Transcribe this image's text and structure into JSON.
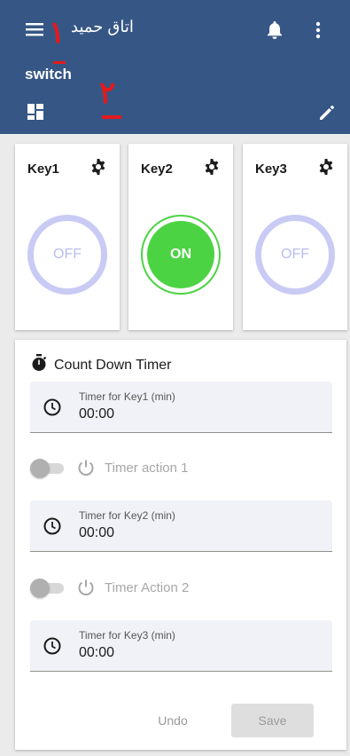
{
  "header": {
    "room_title": "اتاق حمید",
    "subtitle": "switch",
    "annotation_1": "۱",
    "annotation_2": "۲"
  },
  "keys": [
    {
      "label": "Key1",
      "state": "OFF"
    },
    {
      "label": "Key2",
      "state": "ON"
    },
    {
      "label": "Key3",
      "state": "OFF"
    }
  ],
  "timer": {
    "title": "Count Down Timer",
    "fields": [
      {
        "label": "Timer for Key1 (min)",
        "value": "00:00"
      },
      {
        "label": "Timer for Key2 (min)",
        "value": "00:00"
      },
      {
        "label": "Timer for Key3 (min)",
        "value": "00:00"
      }
    ],
    "actions": [
      {
        "label": "Timer action 1"
      },
      {
        "label": "Timer Action 2"
      }
    ],
    "undo_label": "Undo",
    "save_label": "Save"
  },
  "icons": {
    "menu": "menu-icon",
    "bell": "bell-icon",
    "more": "more-vert-icon",
    "dashboard": "dashboard-icon",
    "edit": "edit-icon",
    "gear": "gear-icon",
    "stopwatch": "stopwatch-icon",
    "clock": "clock-icon",
    "power": "power-icon"
  },
  "colors": {
    "header_bg": "#365785",
    "on_green": "#4cd343",
    "off_ring": "#c9cbf5",
    "annotation_red": "#e3191c"
  }
}
